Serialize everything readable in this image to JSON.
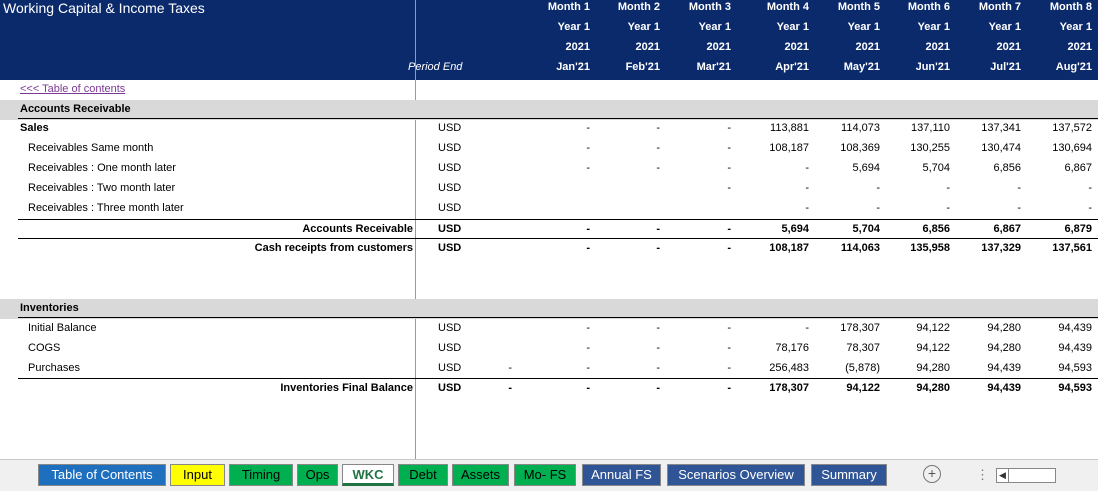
{
  "title": "Working Capital & Income Taxes",
  "period_label": "Period End",
  "toc_link": "<<< Table of contents",
  "columns": [
    {
      "month": "Month 1",
      "year": "Year 1",
      "yr": "2021",
      "date": "Jan'21"
    },
    {
      "month": "Month 2",
      "year": "Year 1",
      "yr": "2021",
      "date": "Feb'21"
    },
    {
      "month": "Month 3",
      "year": "Year 1",
      "yr": "2021",
      "date": "Mar'21"
    },
    {
      "month": "Month 4",
      "year": "Year 1",
      "yr": "2021",
      "date": "Apr'21"
    },
    {
      "month": "Month 5",
      "year": "Year 1",
      "yr": "2021",
      "date": "May'21"
    },
    {
      "month": "Month 6",
      "year": "Year 1",
      "yr": "2021",
      "date": "Jun'21"
    },
    {
      "month": "Month 7",
      "year": "Year 1",
      "yr": "2021",
      "date": "Jul'21"
    },
    {
      "month": "Month 8",
      "year": "Year 1",
      "yr": "2021",
      "date": "Aug'21"
    }
  ],
  "sections": {
    "ar_header": "Accounts Receivable",
    "inv_header": "Inventories"
  },
  "rows": [
    {
      "label": "Sales",
      "cur": "USD",
      "style": "bold",
      "pre": "",
      "vals": [
        "-",
        "-",
        "-",
        "113,881",
        "114,073",
        "137,110",
        "137,341",
        "137,572"
      ]
    },
    {
      "label": "Receivables Same month",
      "cur": "USD",
      "style": "ind",
      "pre": "",
      "vals": [
        "-",
        "-",
        "-",
        "108,187",
        "108,369",
        "130,255",
        "130,474",
        "130,694"
      ]
    },
    {
      "label": "Receivables : One month later",
      "cur": "USD",
      "style": "ind",
      "pre": "",
      "vals": [
        "-",
        "-",
        "-",
        "-",
        "5,694",
        "5,704",
        "6,856",
        "6,867"
      ]
    },
    {
      "label": "Receivables : Two month later",
      "cur": "USD",
      "style": "ind",
      "pre": "",
      "vals": [
        "",
        "",
        "-",
        "-",
        "-",
        "-",
        "-",
        "-"
      ]
    },
    {
      "label": "Receivables : Three month later",
      "cur": "USD",
      "style": "ind",
      "pre": "",
      "vals": [
        "",
        "",
        "",
        "-",
        "-",
        "-",
        "-",
        "-"
      ]
    },
    {
      "label": "Accounts Receivable",
      "cur": "USD",
      "style": "tot",
      "pre": "",
      "vals": [
        "-",
        "-",
        "-",
        "5,694",
        "5,704",
        "6,856",
        "6,867",
        "6,879"
      ]
    },
    {
      "label": "Cash receipts from customers",
      "cur": "USD",
      "style": "tot",
      "pre": "",
      "vals": [
        "-",
        "-",
        "-",
        "108,187",
        "114,063",
        "135,958",
        "137,329",
        "137,561"
      ]
    },
    {
      "label": "Initial Balance",
      "cur": "USD",
      "style": "ind",
      "pre": "",
      "vals": [
        "-",
        "-",
        "-",
        "-",
        "178,307",
        "94,122",
        "94,280",
        "94,439"
      ]
    },
    {
      "label": "COGS",
      "cur": "USD",
      "style": "ind",
      "pre": "",
      "vals": [
        "-",
        "-",
        "-",
        "78,176",
        "78,307",
        "94,122",
        "94,280",
        "94,439"
      ]
    },
    {
      "label": "Purchases",
      "cur": "USD",
      "style": "ind",
      "pre": "-",
      "vals": [
        "-",
        "-",
        "-",
        "256,483",
        "(5,878)",
        "94,280",
        "94,439",
        "94,593"
      ]
    },
    {
      "label": "Inventories Final Balance",
      "cur": "USD",
      "style": "tot",
      "pre": "-",
      "vals": [
        "-",
        "-",
        "-",
        "178,307",
        "94,122",
        "94,280",
        "94,439",
        "94,593"
      ]
    }
  ],
  "tabs": [
    {
      "label": "Table of Contents",
      "color": "#1f6fbf",
      "text": "#ffffff"
    },
    {
      "label": "Input",
      "color": "#ffff00",
      "text": "#000000"
    },
    {
      "label": "Timing",
      "color": "#00b050",
      "text": "#000000"
    },
    {
      "label": "Ops",
      "color": "#00b050",
      "text": "#000000"
    },
    {
      "label": "WKC",
      "color": "#ffffff",
      "text": "#217346"
    },
    {
      "label": "Debt",
      "color": "#00b050",
      "text": "#000000"
    },
    {
      "label": "Assets",
      "color": "#00b050",
      "text": "#000000"
    },
    {
      "label": "Mo- FS",
      "color": "#00b050",
      "text": "#000000"
    },
    {
      "label": "Annual FS",
      "color": "#2f5597",
      "text": "#ffffff"
    },
    {
      "label": "Scenarios Overview",
      "color": "#2f5597",
      "text": "#ffffff"
    },
    {
      "label": "Summary",
      "color": "#2f5597",
      "text": "#ffffff"
    }
  ],
  "add_sheet_symbol": "+",
  "more_symbol": "⋮",
  "scroll_arrow": "◀"
}
